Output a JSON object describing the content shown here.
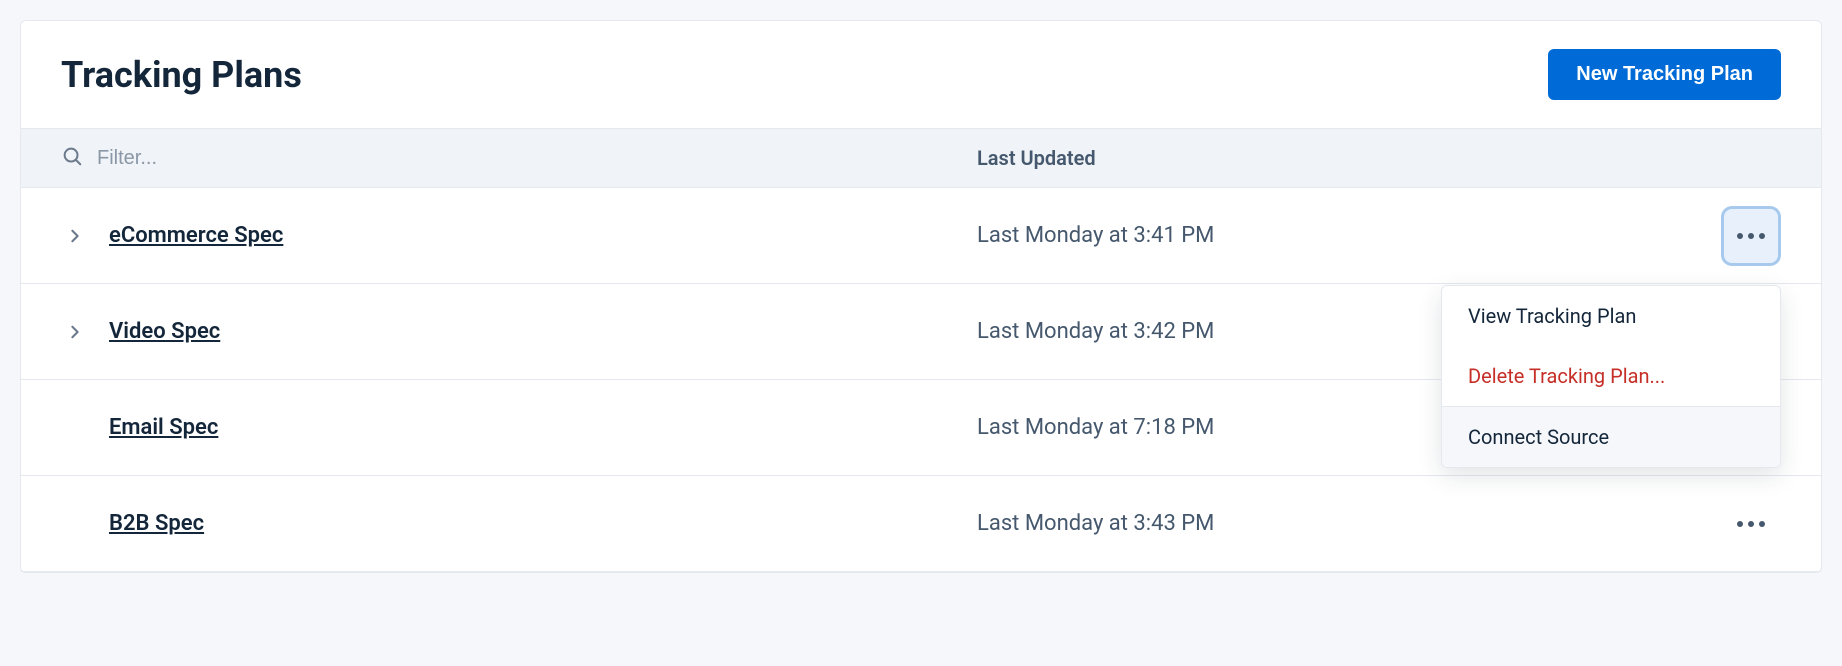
{
  "header": {
    "title": "Tracking Plans",
    "new_button": "New Tracking Plan"
  },
  "filter": {
    "placeholder": "Filter...",
    "column_header": "Last Updated"
  },
  "rows": [
    {
      "name": "eCommerce Spec",
      "updated": "Last Monday at 3:41 PM",
      "expandable": true
    },
    {
      "name": "Video Spec",
      "updated": "Last Monday at 3:42 PM",
      "expandable": true
    },
    {
      "name": "Email Spec",
      "updated": "Last Monday at 7:18 PM",
      "expandable": false
    },
    {
      "name": "B2B Spec",
      "updated": "Last Monday at 3:43 PM",
      "expandable": false
    }
  ],
  "dropdown": {
    "view": "View Tracking Plan",
    "delete": "Delete Tracking Plan...",
    "connect": "Connect Source"
  }
}
